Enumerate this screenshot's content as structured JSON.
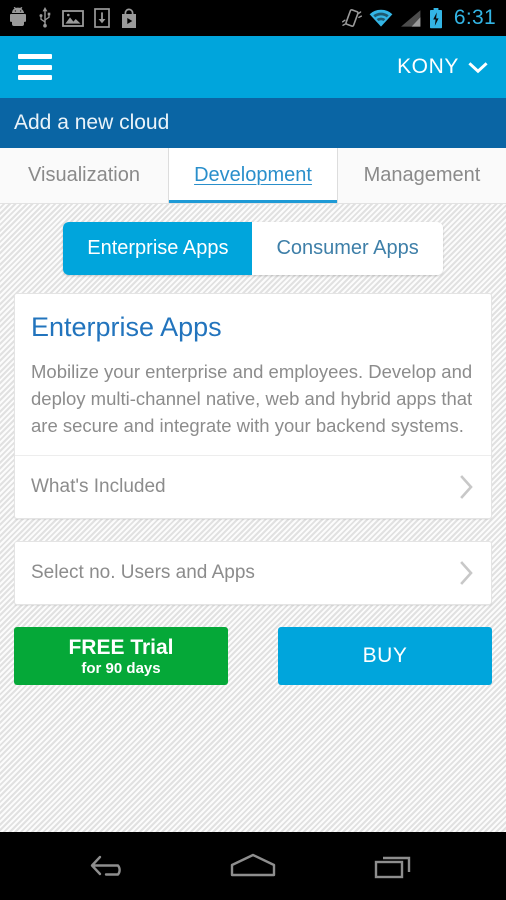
{
  "status_bar": {
    "icons": [
      "android-debug-icon",
      "usb-icon",
      "screenshot-image-icon",
      "download-icon",
      "play-store-icon"
    ],
    "right_icons": [
      "vibrate-icon",
      "wifi-icon",
      "cellular-signal-icon",
      "battery-charging-icon"
    ],
    "time": "6:31",
    "time_color": "#33B5E5"
  },
  "app_bar": {
    "menu_icon": "hamburger-menu-icon",
    "account_name": "KONY",
    "account_chevron": "chevron-down-icon",
    "background_color": "#00A5DC"
  },
  "sub_header": {
    "title": "Add a new cloud",
    "background_color": "#0A65A4"
  },
  "tabs": [
    {
      "label": "Visualization",
      "active": false
    },
    {
      "label": "Development",
      "active": true
    },
    {
      "label": "Management",
      "active": false
    }
  ],
  "segmented": {
    "options": [
      {
        "label": "Enterprise Apps",
        "active": true
      },
      {
        "label": "Consumer Apps",
        "active": false
      }
    ],
    "active_color": "#00A5DC",
    "inactive_text_color": "#3E7FA8"
  },
  "main_card": {
    "title": "Enterprise Apps",
    "title_color": "#2274BD",
    "description": "Mobilize your enterprise and employees. Develop and deploy multi-channel native, web and hybrid apps that are secure and integrate with your backend systems.",
    "row_label": "What's Included",
    "row_chevron": "chevron-right-icon"
  },
  "select_card": {
    "label": "Select no. Users and Apps",
    "chevron": "chevron-right-icon"
  },
  "actions": {
    "free_trial_line1": "FREE Trial",
    "free_trial_line2": "for 90 days",
    "free_trial_color": "#05A838",
    "buy_label": "BUY",
    "buy_color": "#00A5DC"
  },
  "nav_bar": {
    "back": "back-arrow-icon",
    "home": "home-icon",
    "recents": "recent-apps-icon"
  }
}
